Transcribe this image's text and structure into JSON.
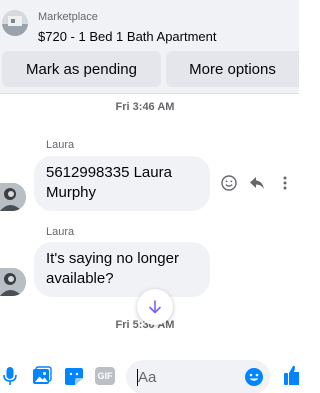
{
  "listing": {
    "label": "Marketplace",
    "title": "$720 - 1 Bed 1 Bath Apartment"
  },
  "actions": {
    "mark_pending": "Mark as pending",
    "more_options": "More options"
  },
  "timestamps": [
    "Fri 3:46 AM",
    "Fri 5:30 AM"
  ],
  "messages": [
    {
      "sender": "Laura",
      "text": "5612998335 Laura Murphy"
    },
    {
      "sender": "Laura",
      "text": "It's saying no longer available?"
    }
  ],
  "composer": {
    "placeholder": "Aa",
    "gif_label": "GIF"
  },
  "colors": {
    "accent": "#0084ff",
    "bubble": "#f0f2f5",
    "button": "#e4e6eb",
    "muted_text": "#65676b"
  },
  "icons": [
    "react-icon",
    "reply-icon",
    "more-icon",
    "scroll-down-icon",
    "mic-icon",
    "photo-icon",
    "sticker-icon",
    "gif-icon",
    "emoji-icon",
    "like-icon"
  ]
}
